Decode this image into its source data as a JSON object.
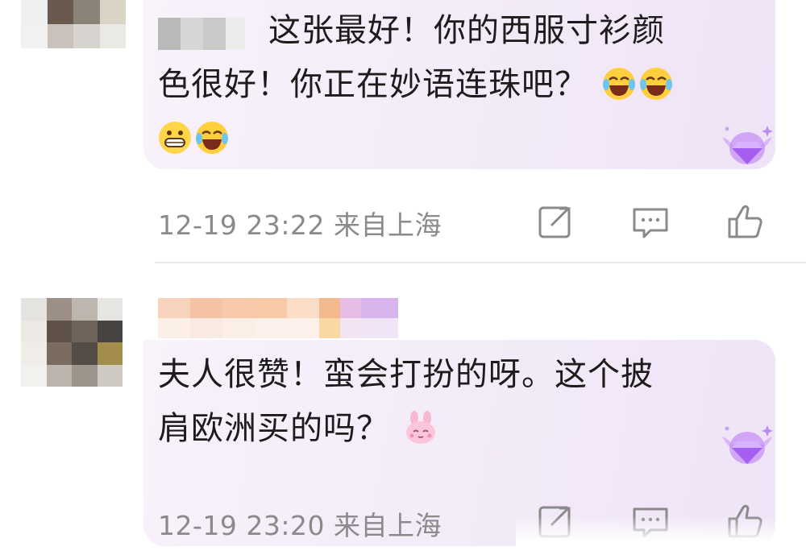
{
  "comments": [
    {
      "text_line1": "这张最好！你的西服寸衫颜",
      "text_line2": "色很好！你正在妙语连珠吧？",
      "emojis": [
        "laugh-cry-icon",
        "laugh-cry-icon",
        "grin-icon",
        "laugh-cry-icon"
      ],
      "timestamp": "12-19 23:22",
      "location": "来自上海"
    },
    {
      "text_line1": "夫人很赞！蛮会打扮的呀。这个披",
      "text_line2": "肩欧洲买的吗？",
      "emojis": [
        "bunny-icon"
      ],
      "timestamp": "12-19 23:20",
      "location": "来自上海"
    }
  ],
  "colors": {
    "bubble": "#f4ebf8",
    "meta_text": "#8a8a8a",
    "badge_purple": "#a55ef0"
  }
}
